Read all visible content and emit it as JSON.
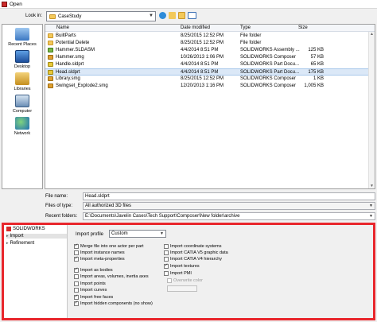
{
  "window": {
    "title": "Open"
  },
  "lookin": {
    "label": "Look in:",
    "folder": "CaseStudy"
  },
  "places": [
    {
      "label": "Recent Places",
      "icon": "recent-places-icon"
    },
    {
      "label": "Desktop",
      "icon": "desktop-icon"
    },
    {
      "label": "Libraries",
      "icon": "libraries-icon"
    },
    {
      "label": "Computer",
      "icon": "computer-icon"
    },
    {
      "label": "Network",
      "icon": "network-icon"
    }
  ],
  "files": {
    "columns": [
      "Name",
      "Date modified",
      "Type",
      "Size"
    ],
    "rows": [
      {
        "name": "BuiltParts",
        "date": "8/25/2015 12:52 PM",
        "type": "File folder",
        "size": "",
        "icon": "folder-icon"
      },
      {
        "name": "Potential Delete",
        "date": "8/25/2015 12:52 PM",
        "type": "File folder",
        "size": "",
        "icon": "folder-icon"
      },
      {
        "name": "Hammer.SLDASM",
        "date": "4/4/2014 8:51 PM",
        "type": "SOLIDWORKS Assembly ...",
        "size": "125 KB",
        "icon": "assembly-file-icon"
      },
      {
        "name": "Hammer.smg",
        "date": "10/26/2013 1:06 PM",
        "type": "SOLIDWORKS Composer",
        "size": "57 KB",
        "icon": "composer-file-icon"
      },
      {
        "name": "Handle.sldprt",
        "date": "4/4/2014 8:51 PM",
        "type": "SOLIDWORKS Part Docu...",
        "size": "65 KB",
        "icon": "part-file-icon"
      },
      {
        "name": "Head.sldprt",
        "date": "4/4/2014 8:51 PM",
        "type": "SOLIDWORKS Part Docu...",
        "size": "175 KB",
        "icon": "part-file-icon"
      },
      {
        "name": "Library.smg",
        "date": "8/25/2015 12:52 PM",
        "type": "SOLIDWORKS Composer",
        "size": "1 KB",
        "icon": "composer-file-icon"
      },
      {
        "name": "Swingset_Explode2.smg",
        "date": "12/20/2013 1:16 PM",
        "type": "SOLIDWORKS Composer",
        "size": "1,005 KB",
        "icon": "composer-file-icon"
      }
    ],
    "selected_index": 5
  },
  "form": {
    "file_name_label": "File name:",
    "file_name_value": "Head.sldprt",
    "files_of_type_label": "Files of type:",
    "files_of_type_value": "All authorized 3D files",
    "recent_folders_label": "Recent folders:",
    "recent_folders_value": "E:\\Documents\\Javelin Cases\\Tech Support\\Composer\\New folder\\archive"
  },
  "options": {
    "tree": {
      "root": "SOLIDWORKS",
      "items": [
        "Import",
        "Refinement"
      ],
      "selected": "Import"
    },
    "profile_label": "Import profile",
    "profile_value": "Custom",
    "left_checks": [
      {
        "label": "Merge file into one actor per part",
        "checked": true
      },
      {
        "label": "Import instance names",
        "checked": false
      },
      {
        "label": "Import meta-properties",
        "checked": true
      },
      {
        "label": "Import as bodies",
        "checked": true
      },
      {
        "label": "Import areas, volumes, inertia axes",
        "checked": false
      },
      {
        "label": "Import points",
        "checked": false
      },
      {
        "label": "Import curves",
        "checked": false
      },
      {
        "label": "Import free faces",
        "checked": true
      },
      {
        "label": "Import hidden components (no show)",
        "checked": true
      }
    ],
    "right_checks": [
      {
        "label": "Import coordinate systems",
        "checked": false
      },
      {
        "label": "Import CATIA V5 graphic data",
        "checked": false
      },
      {
        "label": "Import CATIA V4 hierarchy",
        "checked": false
      },
      {
        "label": "Import textures",
        "checked": true
      },
      {
        "label": "Import PMI",
        "checked": false
      }
    ],
    "overwrite_color_label": "Overwrite color"
  }
}
